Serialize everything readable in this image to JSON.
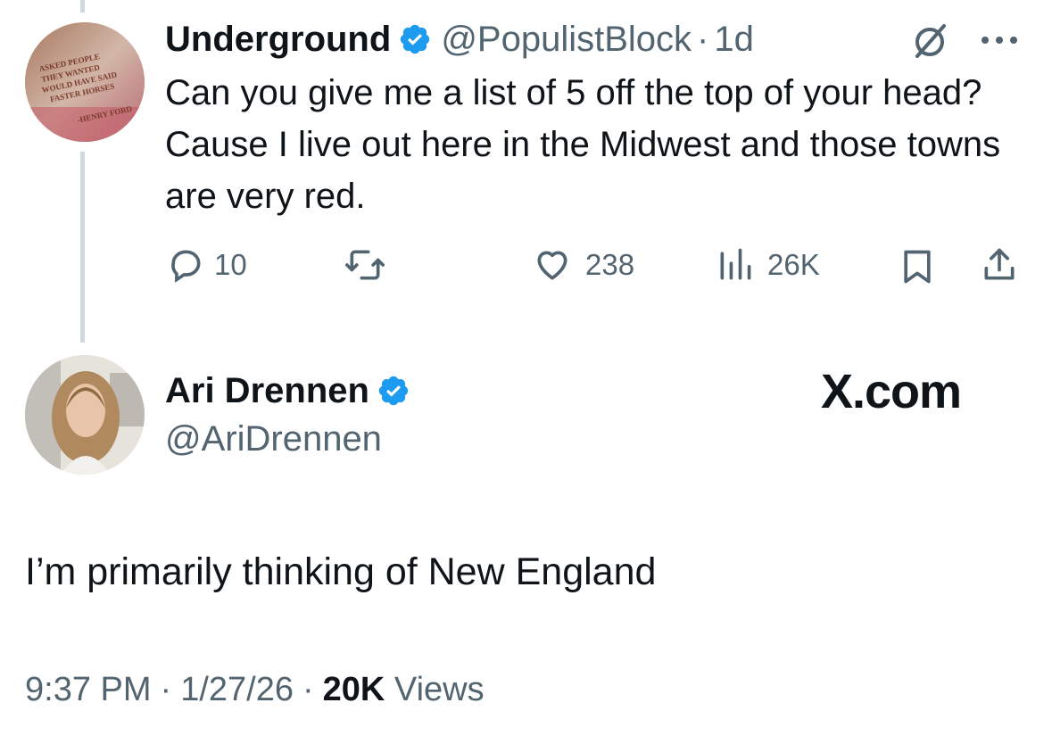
{
  "quoted_tweet": {
    "author_name": "Underground",
    "handle": "@PopulistBlock",
    "separator": "·",
    "time_ago": "1d",
    "text": "Can you give me a list of 5 off the top of your head? Cause I live out here in the Midwest and those towns are very red.",
    "avatar_icon": "avatar-photo-icon",
    "verified_icon": "verified-badge-icon",
    "actions": {
      "replies": "10",
      "reposts": "",
      "likes": "238",
      "views": "26K"
    }
  },
  "reply_tweet": {
    "author_name": "Ari Drennen",
    "handle": "@AriDrennen",
    "text": "I’m primarily thinking of New England",
    "avatar_icon": "avatar-photo-icon",
    "verified_icon": "verified-badge-icon",
    "time": "9:37 PM",
    "date": "1/27/26",
    "separator": "·",
    "views_count": "20K",
    "views_label": "Views"
  },
  "watermark": "X.com",
  "colors": {
    "verified_blue": "#1d9bf0",
    "text_primary": "#0f1419",
    "text_secondary": "#536471",
    "thread_line": "#cfd9de"
  }
}
